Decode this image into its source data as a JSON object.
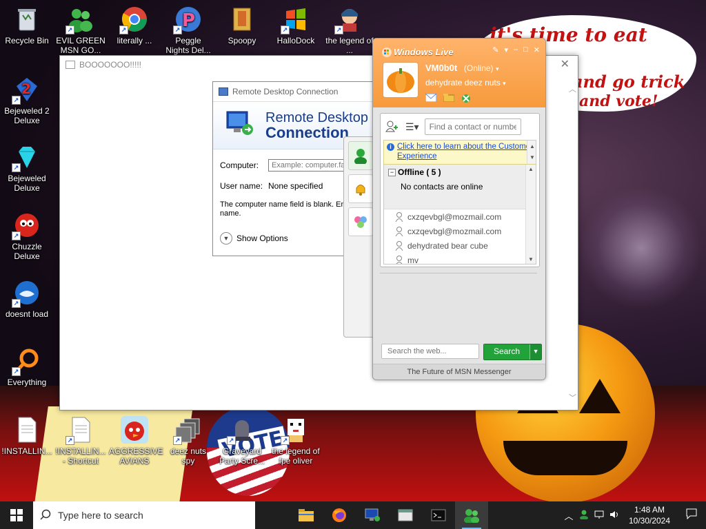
{
  "wallpaper": {
    "cloud_text": [
      "it's time to eat shit",
      "and go trick",
      "and vote!"
    ],
    "vote_sign": "VOTE"
  },
  "desktop_icons": [
    {
      "label": "Recycle Bin"
    },
    {
      "label": "EVIL GREEN MSN GO..."
    },
    {
      "label": "literally ..."
    },
    {
      "label": "Peggle Nights Del..."
    },
    {
      "label": "Spoopy"
    },
    {
      "label": "HalloDock"
    },
    {
      "label": "the legend of ..."
    },
    {
      "label": "Bejeweled 2 Deluxe"
    },
    {
      "label": "Bejeweled Deluxe"
    },
    {
      "label": "Chuzzle Deluxe"
    },
    {
      "label": "doesnt load"
    },
    {
      "label": "Everything"
    },
    {
      "label": "!INSTALLIN..."
    },
    {
      "label": "!INSTALLIN... - Shortcut"
    },
    {
      "label": "AGGRESSIVE AVIANS"
    },
    {
      "label": "deez nuts spy"
    },
    {
      "label": "Graveyard Party Scre..."
    },
    {
      "label": "the legend of fpe oliver"
    }
  ],
  "booo_window": {
    "title": "BOOOOOOO!!!!!"
  },
  "rdc": {
    "title": "Remote Desktop Connection",
    "heading_line1": "Remote Desktop",
    "heading_line2": "Connection",
    "computer_label": "Computer:",
    "computer_placeholder": "Example: computer.fab",
    "user_label": "User name:",
    "user_value": "None specified",
    "message": "The computer name field is blank. Ent name.",
    "show_options": "Show Options"
  },
  "msn": {
    "title": "Windows Live",
    "display_name": "VM0b0t",
    "status": "(Online)",
    "personal_message": "dehydrate deez nuts",
    "find_placeholder": "Find a contact or numbe",
    "info_link": "Click here to learn about the Customer Experience",
    "group_title": "Offline ( 5 )",
    "group_subtitle": "No contacts are online",
    "contacts": [
      {
        "name": "cxzqevbgl@mozmail.com"
      },
      {
        "name": "cxzqevbgl@mozmail.com"
      },
      {
        "name": "dehydrated bear cube"
      },
      {
        "name": "mv"
      }
    ],
    "web_search_placeholder": "Search the web...",
    "search_button": "Search",
    "footer": "The Future of MSN Messenger"
  },
  "taskbar": {
    "search_placeholder": "Type here to search",
    "time": "1:48 AM",
    "date": "10/30/2024"
  },
  "colors": {
    "msn_orange": "#f79a3c",
    "search_green": "#21a33a",
    "rdc_blue": "#1a3d8a",
    "taskbar": "#1f1f1f"
  }
}
